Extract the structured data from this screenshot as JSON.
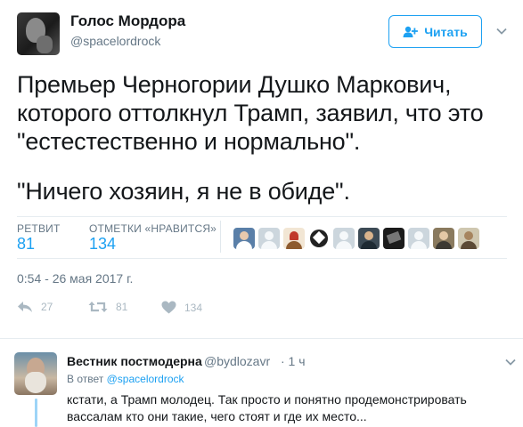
{
  "author": {
    "display_name": "Голос Мордора",
    "handle": "@spacelordrock"
  },
  "follow_button": {
    "label": "Читать"
  },
  "tweet": {
    "lines": [
      "Премьер Черногории Душко Маркович,",
      "которого оттолкнул Трамп, заявил, что это",
      "\"естестественно и нормально\".",
      "\"Ничего хозяин, я не в обиде\"."
    ]
  },
  "stats": {
    "retweets": {
      "label": "РЕТВИТ",
      "value": "81"
    },
    "likes": {
      "label": "ОТМЕТКИ «НРАВИТСЯ»",
      "value": "134"
    }
  },
  "timestamp": "0:54 - 26 мая 2017 г.",
  "actions": {
    "reply_count": "27",
    "retweet_count": "81",
    "like_count": "134"
  },
  "reply": {
    "display_name": "Вестник постмодерна",
    "handle": "@bydlozavr",
    "time": "· 1 ч",
    "in_reply_prefix": "В ответ",
    "in_reply_handle": "@spacelordrock",
    "lines": [
      "кстати, а Трамп молодец. Так просто и понятно продемонстрировать",
      "вассалам кто они такие, чего стоят и где их место..."
    ]
  },
  "colors": {
    "accent": "#1da1f2",
    "text": "#14171a",
    "muted": "#657786"
  }
}
